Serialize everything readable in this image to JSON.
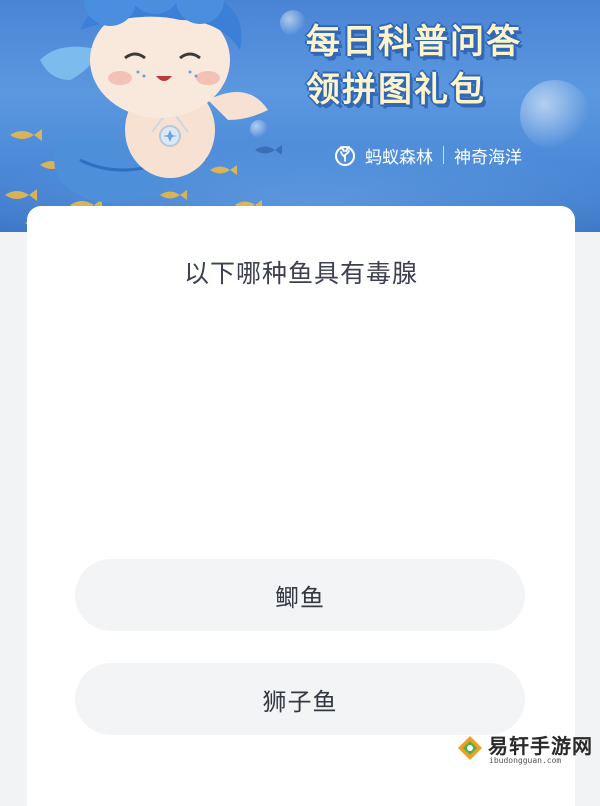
{
  "banner": {
    "title_line1": "每日科普问答",
    "title_line2": "领拼图礼包",
    "brand_name": "蚂蚁森林",
    "brand_sub": "神奇海洋"
  },
  "question": {
    "text": "以下哪种鱼具有毒腺",
    "options": [
      {
        "label": "鲫鱼"
      },
      {
        "label": "狮子鱼"
      }
    ]
  },
  "watermark": {
    "name": "易轩手游网",
    "url": "ibudongguan.com"
  },
  "colors": {
    "banner_blue": "#4a84d4",
    "title_yellow": "#fff4c8",
    "option_bg": "#f3f4f6",
    "question_text": "#3b4150"
  }
}
